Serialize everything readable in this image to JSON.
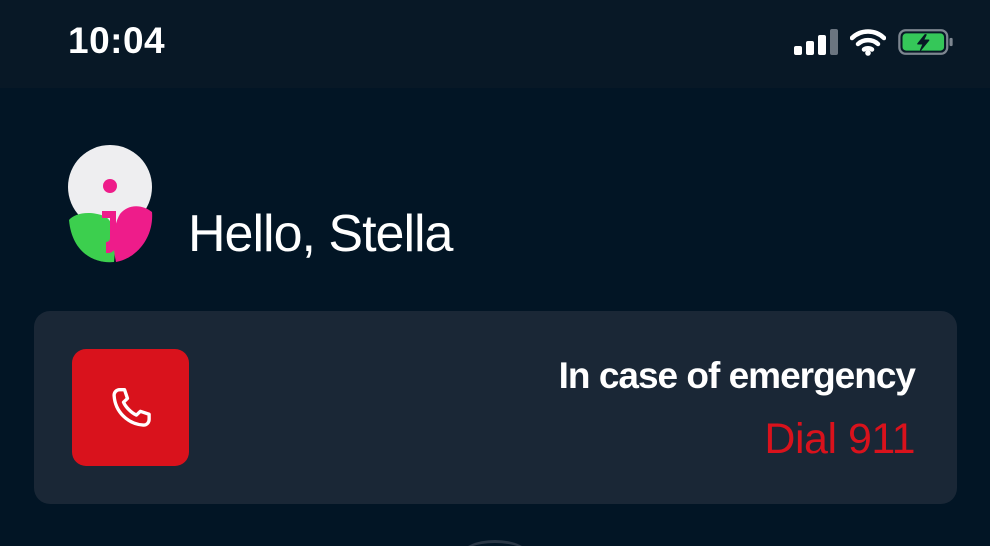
{
  "status_bar": {
    "time": "10:04"
  },
  "greeting": {
    "text": "Hello, Stella",
    "logo_icon": "app-logo-icon"
  },
  "emergency": {
    "title": "In case of emergency",
    "number_label": "Dial 911",
    "call_icon": "phone-icon"
  },
  "colors": {
    "background": "#021525",
    "card": "#1a2736",
    "emergency_red": "#d9121c",
    "battery_green": "#35c759",
    "logo_pink": "#ee1c8a",
    "logo_green": "#3ccf4e"
  }
}
